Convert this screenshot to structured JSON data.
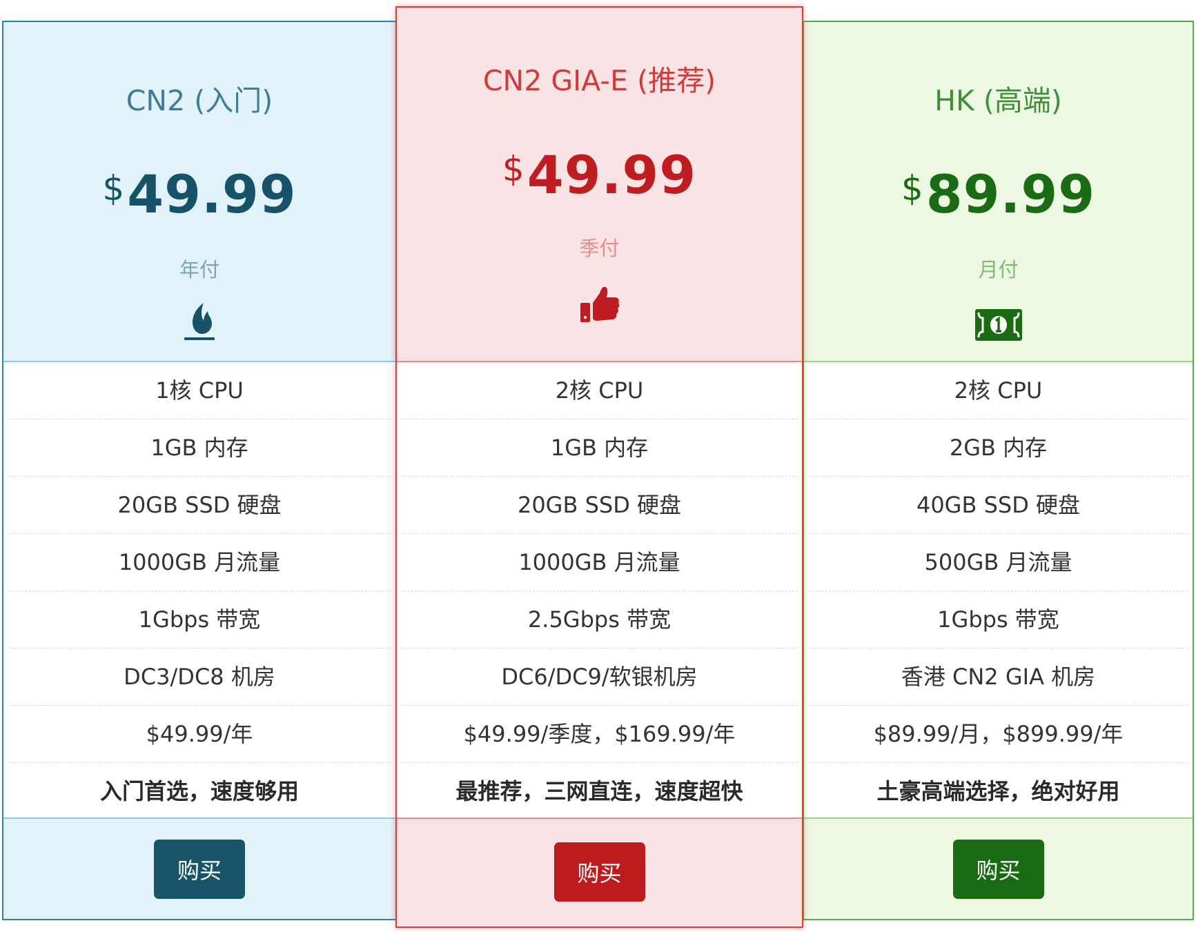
{
  "plans": [
    {
      "title": "CN2 (入门)",
      "currency": "$",
      "price": "49.99",
      "period": "年付",
      "icon": "fire-icon",
      "features": [
        "1核 CPU",
        "1GB 内存",
        "20GB SSD 硬盘",
        "1000GB 月流量",
        "1Gbps 带宽",
        "DC3/DC8 机房",
        "$49.99/年",
        "入门首选，速度够用"
      ],
      "buy_label": "购买",
      "accent": "#175268"
    },
    {
      "title": "CN2 GIA-E (推荐)",
      "currency": "$",
      "price": "49.99",
      "period": "季付",
      "icon": "thumbs-up-icon",
      "features": [
        "2核 CPU",
        "1GB 内存",
        "20GB SSD 硬盘",
        "1000GB 月流量",
        "2.5Gbps 带宽",
        "DC6/DC9/软银机房",
        "$49.99/季度，$169.99/年",
        "最推荐，三网直连，速度超快"
      ],
      "buy_label": "购买",
      "accent": "#be1e22"
    },
    {
      "title": "HK (高端)",
      "currency": "$",
      "price": "89.99",
      "period": "月付",
      "icon": "money-bill-icon",
      "features": [
        "2核 CPU",
        "2GB 内存",
        "40GB SSD 硬盘",
        "500GB 月流量",
        "1Gbps 带宽",
        "香港 CN2 GIA 机房",
        "$89.99/月，$899.99/年",
        "土豪高端选择，绝对好用"
      ],
      "buy_label": "购买",
      "accent": "#1b6b14"
    }
  ]
}
